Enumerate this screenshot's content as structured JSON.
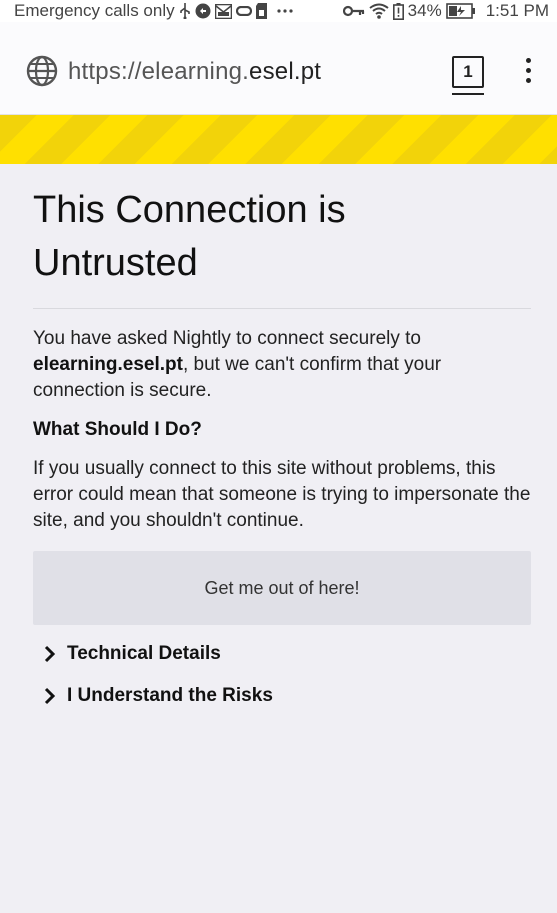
{
  "status_bar": {
    "left_text": "Emergency calls only",
    "battery": "34%",
    "time": "1:51 PM",
    "icons": [
      "usb-icon",
      "sync-icon",
      "gmail-icon",
      "link-icon",
      "sdcard-icon",
      "more-dots-icon",
      "key-icon",
      "wifi-icon",
      "battery-alert-icon",
      "battery-charging-icon"
    ]
  },
  "url_bar": {
    "scheme_prefix": "https://elearning.",
    "host": "esel.pt",
    "tab_count": "1"
  },
  "page": {
    "title_line1": "This Connection is",
    "title_line2": "Untrusted",
    "intro_before": "You have asked Nightly to connect securely to ",
    "intro_host": "elearning.esel.pt",
    "intro_after": ", but we can't confirm that your connection is secure.",
    "what_heading": "What Should I Do?",
    "what_text": "If you usually connect to this site without problems, this error could mean that someone is trying to impersonate the site, and you shouldn't continue.",
    "escape_button": "Get me out of here!",
    "technical_details": "Technical Details",
    "understand_risks": "I Understand the Risks"
  },
  "colors": {
    "stripe_dark": "#f2d30a",
    "stripe_light": "#ffe000",
    "page_bg": "#f0eff4",
    "button_bg": "#e0e0e7"
  }
}
